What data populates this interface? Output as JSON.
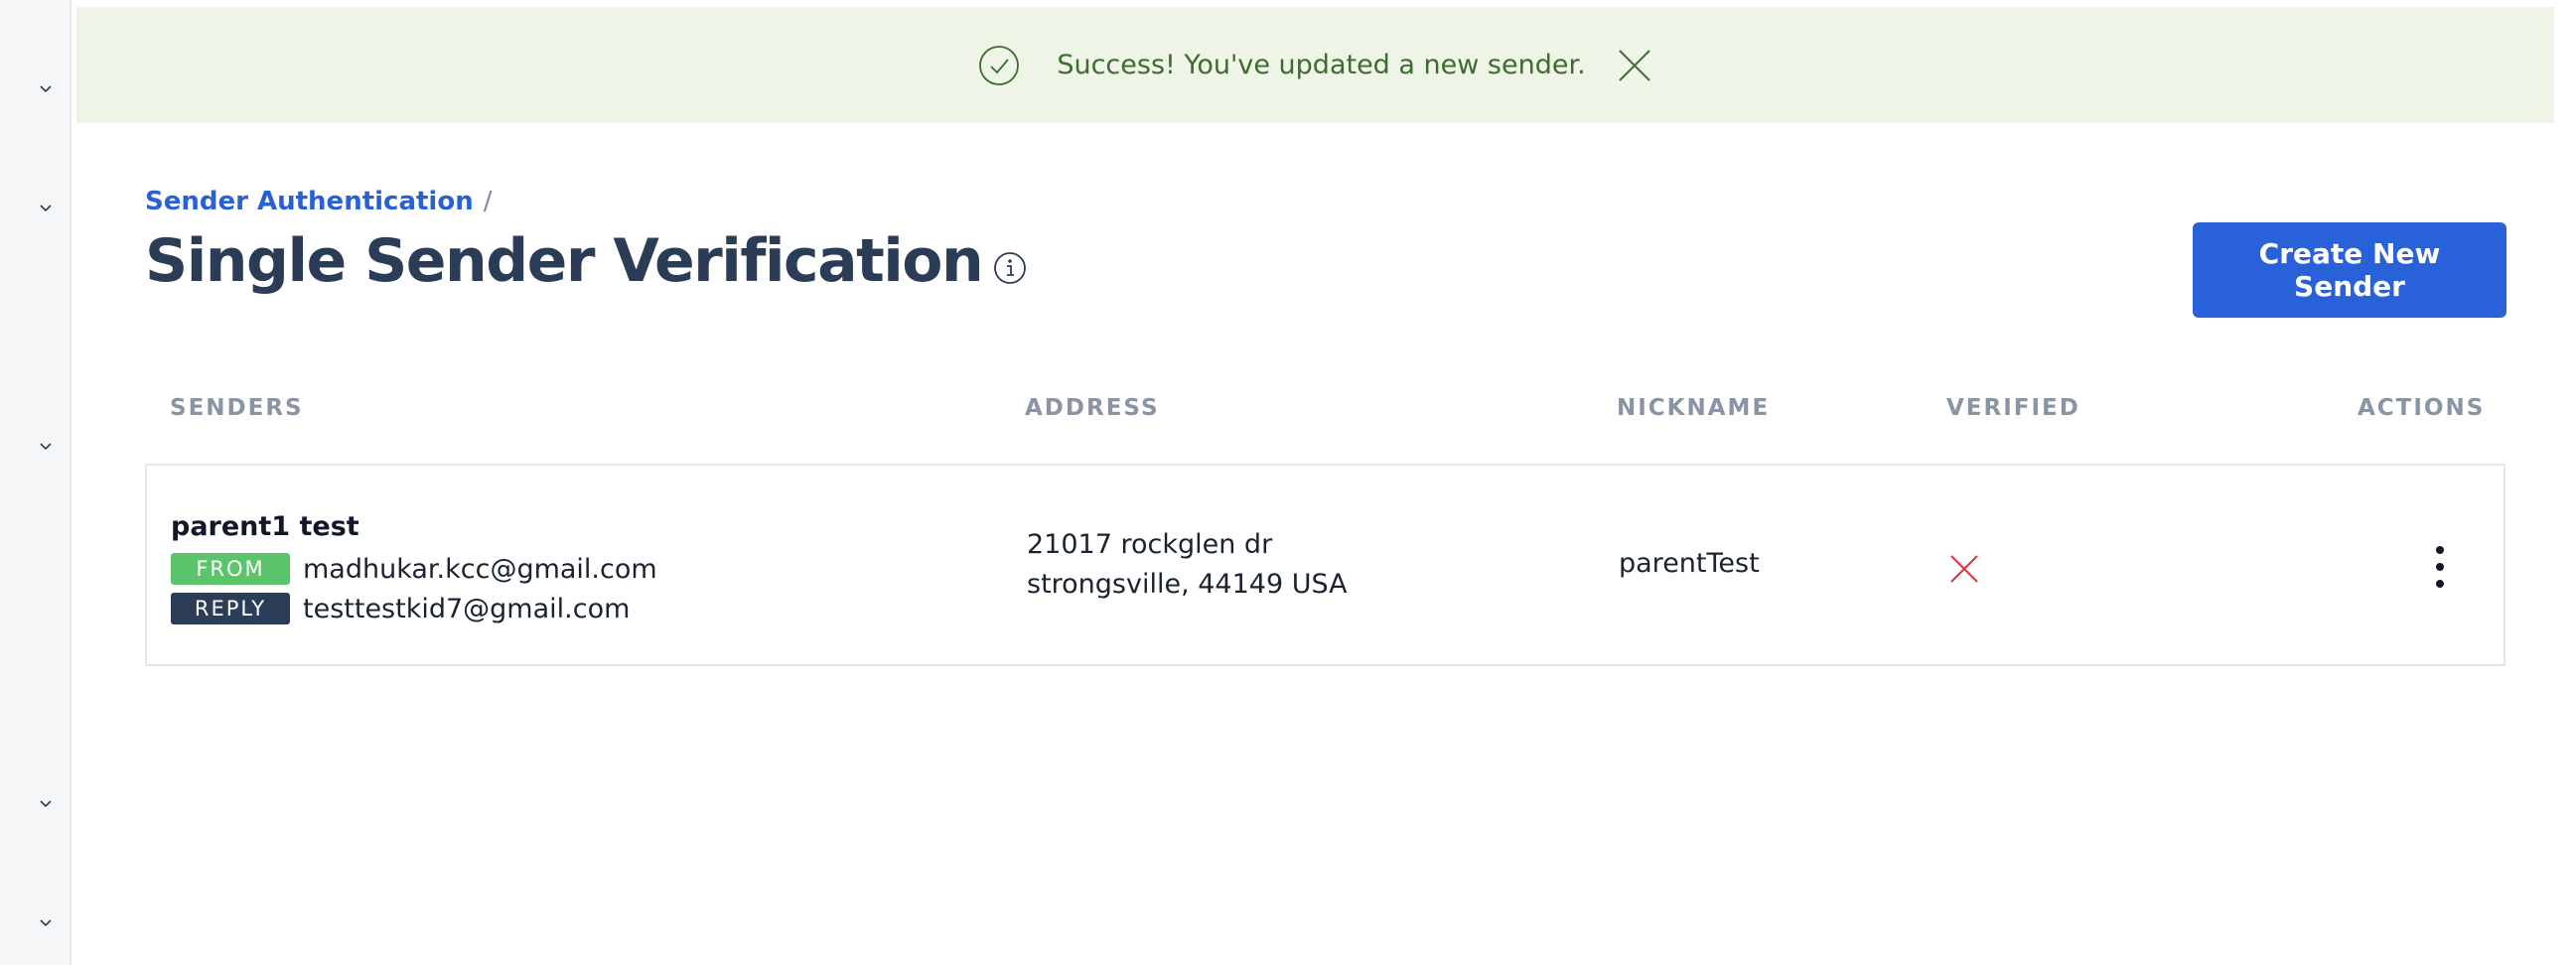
{
  "sidebar": {
    "chevrons": [
      "chevron-down-icon",
      "chevron-down-icon",
      "chevron-down-icon",
      "chevron-down-icon",
      "chevron-down-icon"
    ]
  },
  "banner": {
    "message": "Success! You've updated a new sender.",
    "status_color": "#3d6b30",
    "background": "#eef4e6",
    "icon": "check-circle-icon",
    "close_icon": "close-icon"
  },
  "breadcrumb": {
    "parent": "Sender Authentication",
    "separator": "/"
  },
  "page": {
    "title": "Single Sender Verification",
    "info_icon": "info-icon"
  },
  "toolbar": {
    "create_label": "Create New Sender",
    "accent": "#2962d8"
  },
  "table": {
    "headers": {
      "senders": "SENDERS",
      "address": "ADDRESS",
      "nickname": "NICKNAME",
      "verified": "VERIFIED",
      "actions": "ACTIONS"
    },
    "rows": [
      {
        "name": "parent1 test",
        "from_tag": "FROM",
        "from_email": "madhukar.kcc@gmail.com",
        "reply_tag": "REPLY",
        "reply_email": "testtestkid7@gmail.com",
        "address_line1": "21017 rockglen dr",
        "address_line2": "strongsville, 44149 USA",
        "nickname": "parentTest",
        "verified": false,
        "verified_icon": "x-icon",
        "actions_icon": "more-vertical-icon"
      }
    ]
  }
}
